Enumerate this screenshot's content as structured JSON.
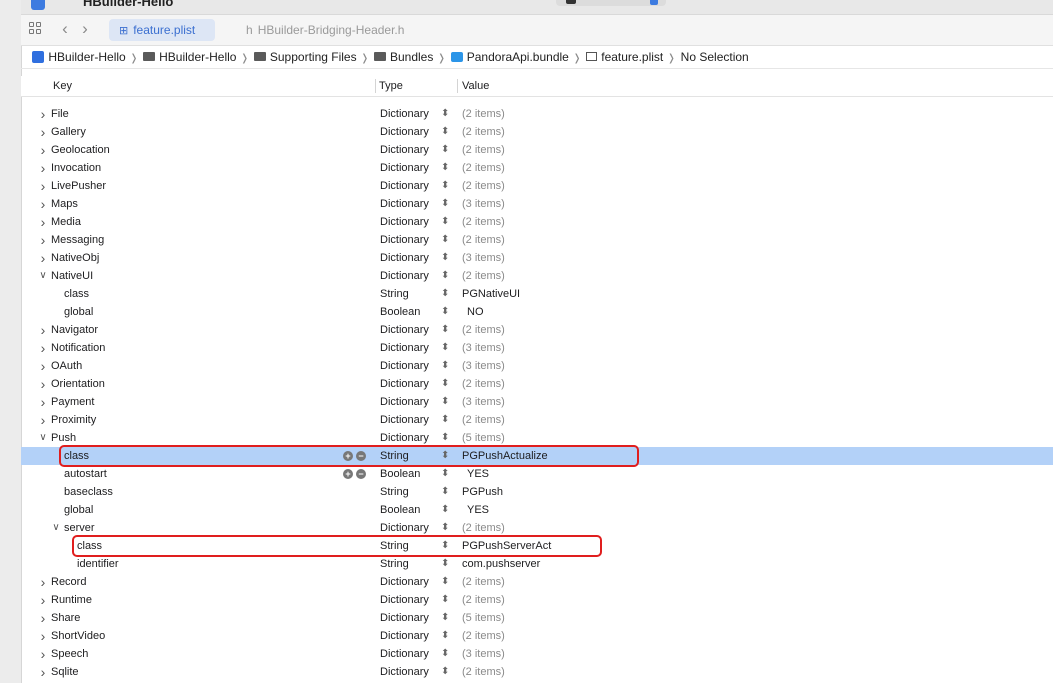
{
  "window": {
    "title": "HBuilder-Hello"
  },
  "tabs": [
    {
      "label": "feature.plist",
      "active": true,
      "icon": "plist-icon"
    },
    {
      "label": "HBuilder-Bridging-Header.h",
      "active": false,
      "icon": "h-file-icon"
    }
  ],
  "breadcrumb": [
    {
      "label": "HBuilder-Hello",
      "icon": "app-icon"
    },
    {
      "label": "HBuilder-Hello",
      "icon": "folder-icon"
    },
    {
      "label": "Supporting Files",
      "icon": "folder-icon"
    },
    {
      "label": "Bundles",
      "icon": "folder-icon"
    },
    {
      "label": "PandoraApi.bundle",
      "icon": "bundle-icon"
    },
    {
      "label": "feature.plist",
      "icon": "plist-icon"
    },
    {
      "label": "No Selection",
      "icon": ""
    }
  ],
  "columns": {
    "key": "Key",
    "type": "Type",
    "value": "Value"
  },
  "rows": [
    {
      "key": "File",
      "level": 0,
      "expandable": true,
      "expanded": false,
      "type": "Dictionary",
      "value": "(2 items)",
      "muted": true
    },
    {
      "key": "Gallery",
      "level": 0,
      "expandable": true,
      "expanded": false,
      "type": "Dictionary",
      "value": "(2 items)",
      "muted": true
    },
    {
      "key": "Geolocation",
      "level": 0,
      "expandable": true,
      "expanded": false,
      "type": "Dictionary",
      "value": "(2 items)",
      "muted": true
    },
    {
      "key": "Invocation",
      "level": 0,
      "expandable": true,
      "expanded": false,
      "type": "Dictionary",
      "value": "(2 items)",
      "muted": true
    },
    {
      "key": "LivePusher",
      "level": 0,
      "expandable": true,
      "expanded": false,
      "type": "Dictionary",
      "value": "(2 items)",
      "muted": true
    },
    {
      "key": "Maps",
      "level": 0,
      "expandable": true,
      "expanded": false,
      "type": "Dictionary",
      "value": "(3 items)",
      "muted": true
    },
    {
      "key": "Media",
      "level": 0,
      "expandable": true,
      "expanded": false,
      "type": "Dictionary",
      "value": "(2 items)",
      "muted": true
    },
    {
      "key": "Messaging",
      "level": 0,
      "expandable": true,
      "expanded": false,
      "type": "Dictionary",
      "value": "(2 items)",
      "muted": true
    },
    {
      "key": "NativeObj",
      "level": 0,
      "expandable": true,
      "expanded": false,
      "type": "Dictionary",
      "value": "(3 items)",
      "muted": true
    },
    {
      "key": "NativeUI",
      "level": 0,
      "expandable": true,
      "expanded": true,
      "type": "Dictionary",
      "value": "(2 items)",
      "muted": true
    },
    {
      "key": "class",
      "level": 1,
      "expandable": false,
      "type": "String",
      "value": "PGNativeUI",
      "muted": false
    },
    {
      "key": "global",
      "level": 1,
      "expandable": false,
      "type": "Boolean",
      "value": "NO",
      "muted": false,
      "bool": true
    },
    {
      "key": "Navigator",
      "level": 0,
      "expandable": true,
      "expanded": false,
      "type": "Dictionary",
      "value": "(2 items)",
      "muted": true
    },
    {
      "key": "Notification",
      "level": 0,
      "expandable": true,
      "expanded": false,
      "type": "Dictionary",
      "value": "(3 items)",
      "muted": true
    },
    {
      "key": "OAuth",
      "level": 0,
      "expandable": true,
      "expanded": false,
      "type": "Dictionary",
      "value": "(3 items)",
      "muted": true
    },
    {
      "key": "Orientation",
      "level": 0,
      "expandable": true,
      "expanded": false,
      "type": "Dictionary",
      "value": "(2 items)",
      "muted": true
    },
    {
      "key": "Payment",
      "level": 0,
      "expandable": true,
      "expanded": false,
      "type": "Dictionary",
      "value": "(3 items)",
      "muted": true
    },
    {
      "key": "Proximity",
      "level": 0,
      "expandable": true,
      "expanded": false,
      "type": "Dictionary",
      "value": "(2 items)",
      "muted": true
    },
    {
      "key": "Push",
      "level": 0,
      "expandable": true,
      "expanded": true,
      "type": "Dictionary",
      "value": "(5 items)",
      "muted": true
    },
    {
      "key": "class",
      "level": 1,
      "expandable": false,
      "type": "String",
      "value": "PGPushActualize",
      "muted": false,
      "selected": true,
      "controls": true,
      "highlight": true
    },
    {
      "key": "autostart",
      "level": 1,
      "expandable": false,
      "type": "Boolean",
      "value": "YES",
      "muted": false,
      "bool": true,
      "controls": true
    },
    {
      "key": "baseclass",
      "level": 1,
      "expandable": false,
      "type": "String",
      "value": "PGPush",
      "muted": false
    },
    {
      "key": "global",
      "level": 1,
      "expandable": false,
      "type": "Boolean",
      "value": "YES",
      "muted": false,
      "bool": true
    },
    {
      "key": "server",
      "level": 1,
      "expandable": true,
      "expanded": true,
      "type": "Dictionary",
      "value": "(2 items)",
      "muted": true
    },
    {
      "key": "class",
      "level": 2,
      "expandable": false,
      "type": "String",
      "value": "PGPushServerAct",
      "muted": false,
      "highlight": true
    },
    {
      "key": "identifier",
      "level": 2,
      "expandable": false,
      "type": "String",
      "value": "com.pushserver",
      "muted": false
    },
    {
      "key": "Record",
      "level": 0,
      "expandable": true,
      "expanded": false,
      "type": "Dictionary",
      "value": "(2 items)",
      "muted": true
    },
    {
      "key": "Runtime",
      "level": 0,
      "expandable": true,
      "expanded": false,
      "type": "Dictionary",
      "value": "(2 items)",
      "muted": true
    },
    {
      "key": "Share",
      "level": 0,
      "expandable": true,
      "expanded": false,
      "type": "Dictionary",
      "value": "(5 items)",
      "muted": true
    },
    {
      "key": "ShortVideo",
      "level": 0,
      "expandable": true,
      "expanded": false,
      "type": "Dictionary",
      "value": "(2 items)",
      "muted": true
    },
    {
      "key": "Speech",
      "level": 0,
      "expandable": true,
      "expanded": false,
      "type": "Dictionary",
      "value": "(3 items)",
      "muted": true
    },
    {
      "key": "Sqlite",
      "level": 0,
      "expandable": true,
      "expanded": false,
      "type": "Dictionary",
      "value": "(2 items)",
      "muted": true
    }
  ],
  "colors": {
    "selection": "#b3d1f8",
    "highlight_border": "#e01e1e",
    "accent": "#3b6fd0"
  }
}
